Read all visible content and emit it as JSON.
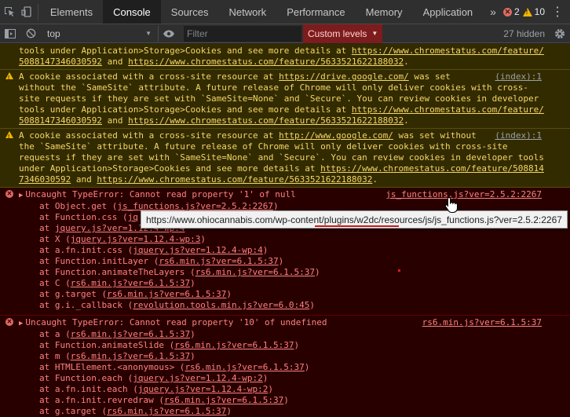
{
  "tabs": {
    "items": [
      {
        "label": "Elements"
      },
      {
        "label": "Console"
      },
      {
        "label": "Sources"
      },
      {
        "label": "Network"
      },
      {
        "label": "Performance"
      },
      {
        "label": "Memory"
      },
      {
        "label": "Application"
      }
    ],
    "more": "»",
    "error_count": "2",
    "warning_count": "10",
    "active": "Console"
  },
  "toolbar": {
    "context": "top",
    "filter_placeholder": "Filter",
    "levels_label": "Custom levels",
    "hidden_count": "27 hidden"
  },
  "colors": {
    "warning_bg": "#332b00",
    "warning_text": "#f4d66a",
    "error_bg": "#290000",
    "error_text": "#ff8080",
    "levels_bg": "#7d1c1c"
  },
  "messages": [
    {
      "type": "warning-tail",
      "lines": [
        {
          "t": "tools under Application>Storage>Cookies and see more details at ",
          "u": "https://www.chromestatus.com/feature/"
        },
        {
          "u": "5088147346030592",
          "t": " and ",
          "u2": "https://www.chromestatus.com/feature/5633521622188032",
          "t2": "."
        }
      ]
    },
    {
      "type": "warning",
      "source": "(index):1",
      "lines": [
        {
          "t": "A cookie associated with a cross-site resource at ",
          "u": "https://drive.google.com/",
          "t2": " was set"
        },
        {
          "t": "without the `SameSite` attribute. A future release of Chrome will only deliver cookies with cross-"
        },
        {
          "t": "site requests if they are set with `SameSite=None` and `Secure`. You can review cookies in developer"
        },
        {
          "t": "tools under Application>Storage>Cookies and see more details at ",
          "u": "https://www.chromestatus.com/feature/"
        },
        {
          "u": "5088147346030592",
          "t": " and ",
          "u2": "https://www.chromestatus.com/feature/5633521622188032",
          "t2": "."
        }
      ]
    },
    {
      "type": "warning",
      "source": "(index):1",
      "lines": [
        {
          "t": "A cookie associated with a cross-site resource at ",
          "u": "http://www.google.com/",
          "t2": " was set without"
        },
        {
          "t": "the `SameSite` attribute. A future release of Chrome will only deliver cookies with cross-site"
        },
        {
          "t": "requests if they are set with `SameSite=None` and `Secure`. You can review cookies in developer tools"
        },
        {
          "t": "under Application>Storage>Cookies and see more details at ",
          "u": "https://www.chromestatus.com/feature/508814"
        },
        {
          "u": "7346030592",
          "t": " and ",
          "u2": "https://www.chromestatus.com/feature/5633521622188032",
          "t2": "."
        }
      ]
    },
    {
      "type": "error",
      "message": "Uncaught TypeError: Cannot read property '1' of null",
      "source": "js_functions.js?ver=2.5.2:2267",
      "stack": [
        {
          "fn": "at Object.get (",
          "src": "js_functions.js?ver=2.5.2:2267",
          "end": ")"
        },
        {
          "fn": "at Function.css (",
          "src": "jq",
          "end": ""
        },
        {
          "fn": "at ",
          "src": "jquery.js?ver=1.12.4-wp:4",
          "end": ""
        },
        {
          "fn": "at X (",
          "src": "jquery.js?ver=1.12.4-wp:3",
          "end": ")"
        },
        {
          "fn": "at a.fn.init.css (",
          "src": "jquery.js?ver=1.12.4-wp:4",
          "end": ")"
        },
        {
          "fn": "at Function.initLayer (",
          "src": "rs6.min.js?ver=6.1.5:37",
          "end": ")"
        },
        {
          "fn": "at Function.animateTheLayers (",
          "src": "rs6.min.js?ver=6.1.5:37",
          "end": ")"
        },
        {
          "fn": "at C (",
          "src": "rs6.min.js?ver=6.1.5:37",
          "end": ")"
        },
        {
          "fn": "at g.target (",
          "src": "rs6.min.js?ver=6.1.5:37",
          "end": ")"
        },
        {
          "fn": "at g.i._callback (",
          "src": "revolution.tools.min.js?ver=6.0:45",
          "end": ")"
        }
      ]
    },
    {
      "type": "error",
      "message": "Uncaught TypeError: Cannot read property '10' of undefined",
      "source": "rs6.min.js?ver=6.1.5:37",
      "stack": [
        {
          "fn": "at a (",
          "src": "rs6.min.js?ver=6.1.5:37",
          "end": ")"
        },
        {
          "fn": "at Function.animateSlide (",
          "src": "rs6.min.js?ver=6.1.5:37",
          "end": ")"
        },
        {
          "fn": "at m (",
          "src": "rs6.min.js?ver=6.1.5:37",
          "end": ")"
        },
        {
          "fn": "at HTMLElement.<anonymous> (",
          "src": "rs6.min.js?ver=6.1.5:37",
          "end": ")"
        },
        {
          "fn": "at Function.each (",
          "src": "jquery.js?ver=1.12.4-wp:2",
          "end": ")"
        },
        {
          "fn": "at a.fn.init.each (",
          "src": "jquery.js?ver=1.12.4-wp:2",
          "end": ")"
        },
        {
          "fn": "at a.fn.init.revredraw (",
          "src": "rs6.min.js?ver=6.1.5:37",
          "end": ")"
        },
        {
          "fn": "at g.target (",
          "src": "rs6.min.js?ver=6.1.5:37",
          "end": ")"
        }
      ]
    }
  ],
  "tooltip": {
    "url": "https://www.ohiocannabis.com/wp-content/plugins/w2dc/resources/js/js_functions.js?ver=2.5.2:2267"
  }
}
